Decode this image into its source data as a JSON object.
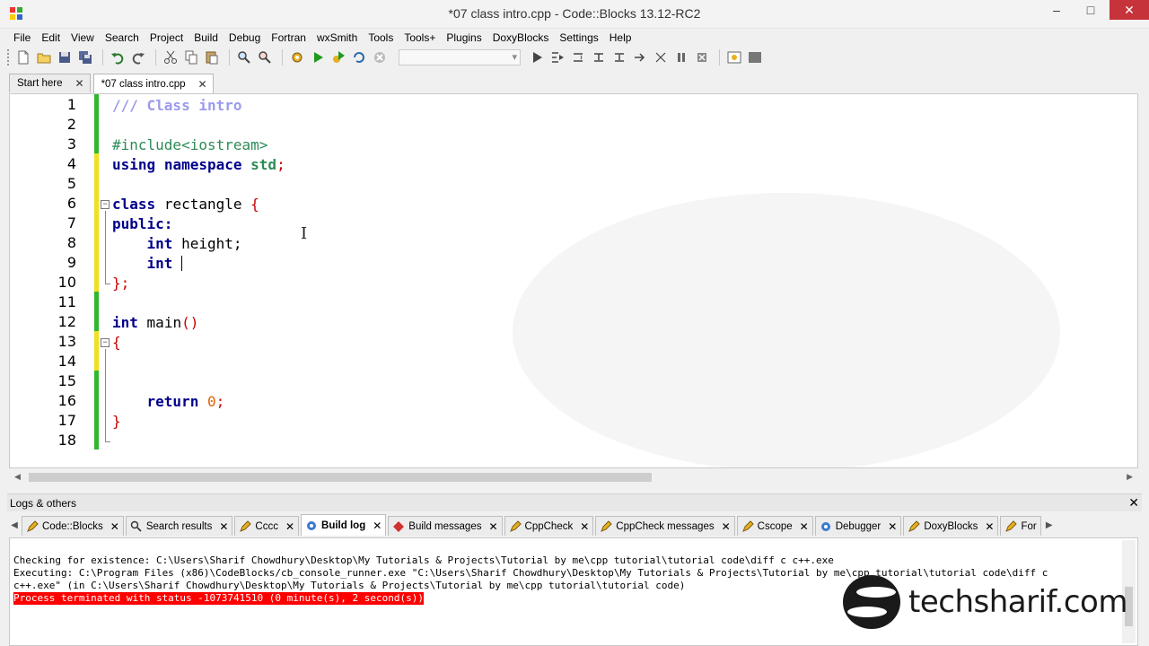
{
  "window": {
    "title": "*07 class intro.cpp - Code::Blocks 13.12-RC2"
  },
  "menu": [
    "File",
    "Edit",
    "View",
    "Search",
    "Project",
    "Build",
    "Debug",
    "Fortran",
    "wxSmith",
    "Tools",
    "Tools+",
    "Plugins",
    "DoxyBlocks",
    "Settings",
    "Help"
  ],
  "editor_tabs": [
    {
      "label": "Start here",
      "active": false
    },
    {
      "label": "*07 class intro.cpp",
      "active": true
    }
  ],
  "code": {
    "line_numbers": [
      "1",
      "2",
      "3",
      "4",
      "5",
      "6",
      "7",
      "8",
      "9",
      "10",
      "11",
      "12",
      "13",
      "14",
      "15",
      "16",
      "17",
      "18"
    ],
    "l1": "/// Class intro",
    "l3": "#include<iostream>",
    "l4_kw1": "using",
    "l4_kw2": "namespace",
    "l4_kw3": "std",
    "l4_semi": ";",
    "l6_kw": "class",
    "l6_name": "rectangle",
    "l6_brace": "{",
    "l7": "public:",
    "l8_kw": "int",
    "l8_rest": "height;",
    "l9_kw": "int",
    "l10": "};",
    "l12_kw": "int",
    "l12_name": "main",
    "l12_paren": "()",
    "l13": "{",
    "l16_kw": "return",
    "l16_num": "0",
    "l16_semi": ";",
    "l17": "}"
  },
  "logs": {
    "header": "Logs & others",
    "tabs": [
      "Code::Blocks",
      "Search results",
      "Cccc",
      "Build log",
      "Build messages",
      "CppCheck",
      "CppCheck messages",
      "Cscope",
      "Debugger",
      "DoxyBlocks",
      "For"
    ],
    "active_tab": "Build log",
    "lines": [
      "Checking for existence: C:\\Users\\Sharif Chowdhury\\Desktop\\My Tutorials & Projects\\Tutorial by me\\cpp tutorial\\tutorial code\\diff c c++.exe",
      "Executing: C:\\Program Files (x86)\\CodeBlocks/cb_console_runner.exe \"C:\\Users\\Sharif Chowdhury\\Desktop\\My Tutorials & Projects\\Tutorial by me\\cpp tutorial\\tutorial code\\diff c",
      "c++.exe\" (in C:\\Users\\Sharif Chowdhury\\Desktop\\My Tutorials & Projects\\Tutorial by me\\cpp tutorial\\tutorial code)",
      "Process terminated with status -1073741510 (0 minute(s), 2 second(s))"
    ]
  },
  "brand": {
    "name": "techsharif.com"
  },
  "colors": {
    "keyword": "#00008b",
    "comment": "#9a9aee",
    "preprocessor": "#2e8b57",
    "brace": "#cc0000",
    "number": "#e06000",
    "change_saved": "#2fb72f",
    "change_unsaved": "#f0e020",
    "error_bg": "#ff0000"
  }
}
